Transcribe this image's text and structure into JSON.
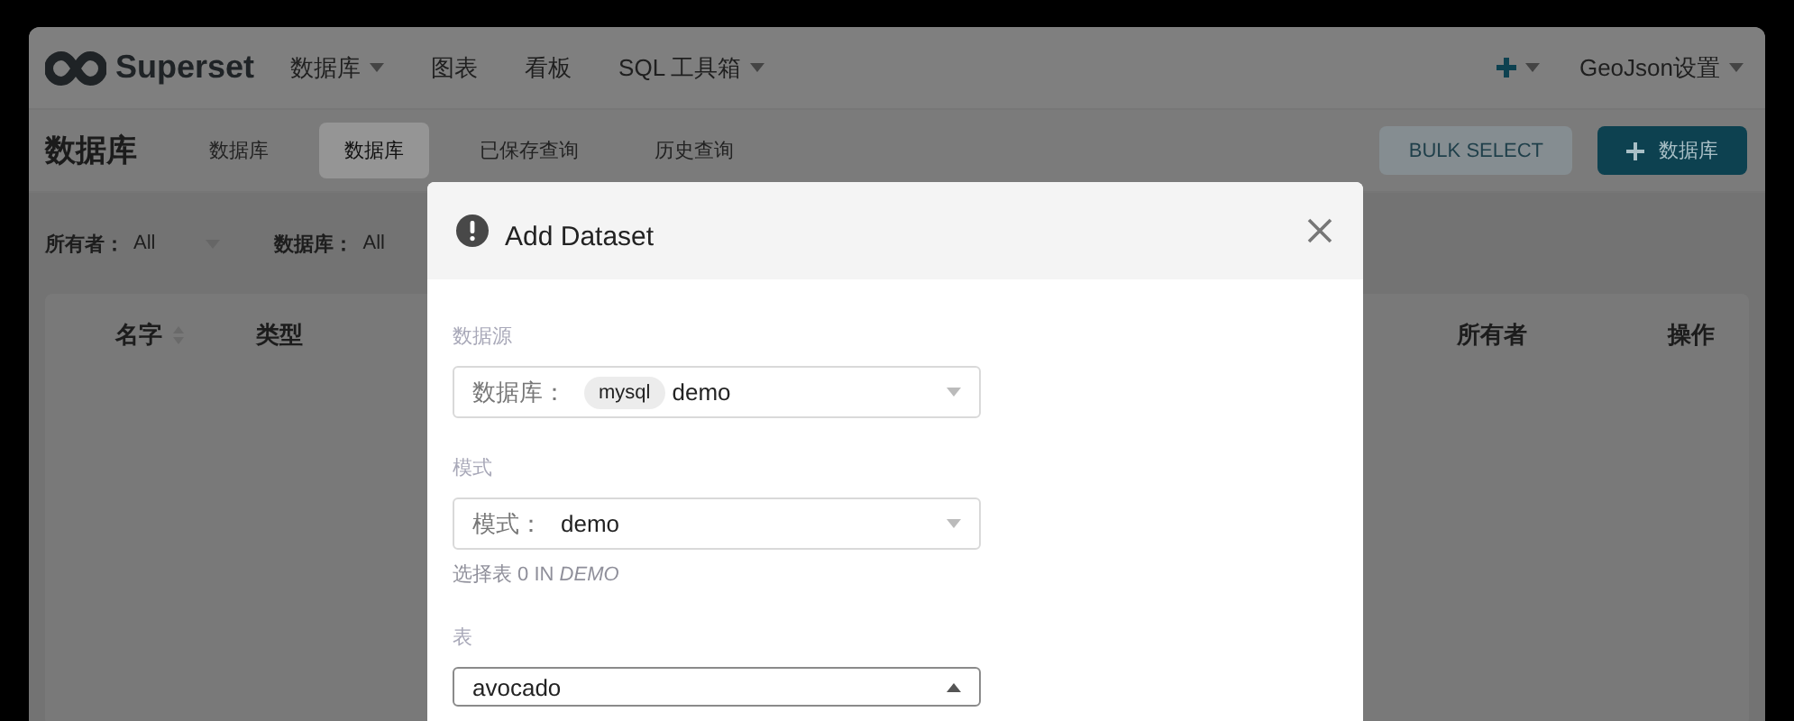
{
  "navbar": {
    "brand": "Superset",
    "menu": [
      {
        "label": "数据库",
        "dropdown": true
      },
      {
        "label": "图表",
        "dropdown": false
      },
      {
        "label": "看板",
        "dropdown": false
      },
      {
        "label": "SQL 工具箱",
        "dropdown": true
      }
    ],
    "right": [
      {
        "kind": "add",
        "dropdown": true
      },
      {
        "kind": "text",
        "label": "GeoJson设置",
        "dropdown": true
      }
    ]
  },
  "subheader": {
    "title": "数据库",
    "tabs": [
      {
        "label": "数据库",
        "selected": false
      },
      {
        "label": "数据库",
        "selected": true
      },
      {
        "label": "已保存查询",
        "selected": false
      },
      {
        "label": "历史查询",
        "selected": false
      }
    ],
    "buttons": [
      {
        "kind": "secondary",
        "label": "BULK SELECT"
      },
      {
        "kind": "primary",
        "label": "数据库"
      }
    ]
  },
  "filters": [
    {
      "label": "所有者：",
      "value": "All"
    },
    {
      "label": "数据库：",
      "value": "All"
    }
  ],
  "table": {
    "columns": [
      {
        "label": "名字",
        "sortable": true
      },
      {
        "label": "类型",
        "sortable": false
      },
      {
        "label": "所有者",
        "sortable": false
      },
      {
        "label": "操作",
        "sortable": false
      }
    ]
  },
  "modal": {
    "title": "Add Dataset",
    "sections": [
      {
        "label": "数据源",
        "select": {
          "prefix": "数据库：",
          "tag": "mysql",
          "value": "demo",
          "open": false
        }
      },
      {
        "label": "模式",
        "select": {
          "prefix": "模式：",
          "value": "demo",
          "open": false
        },
        "hint": "选择表 0 IN *DEMO*"
      },
      {
        "label": "表",
        "select": {
          "value": "avocado",
          "open": true
        }
      }
    ]
  }
}
